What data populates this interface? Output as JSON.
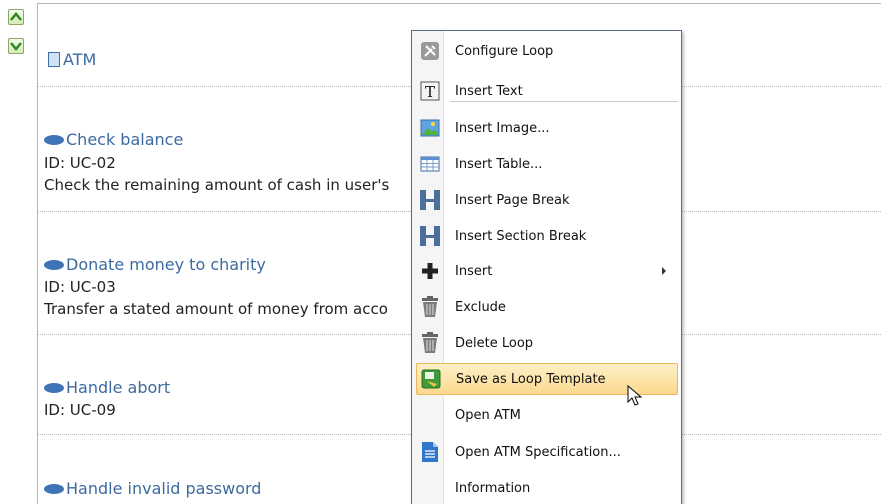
{
  "document": {
    "title": "ATM",
    "use_cases": [
      {
        "name": "Check balance",
        "id": "ID: UC-02",
        "description": "Check the remaining amount of cash in user's"
      },
      {
        "name": "Donate money to charity",
        "id": "ID: UC-03",
        "description": "Transfer a stated amount of money from acco"
      },
      {
        "name": "Handle abort",
        "id": "ID: UC-09"
      },
      {
        "name": "Handle invalid password"
      }
    ]
  },
  "context_menu": {
    "items": [
      {
        "label": "Configure Loop",
        "icon": "wrench-icon"
      },
      {
        "label": "Insert Text",
        "icon": "text-t-icon"
      },
      {
        "label": "Insert Image...",
        "icon": "image-icon"
      },
      {
        "label": "Insert Table...",
        "icon": "table-icon"
      },
      {
        "label": "Insert Page Break",
        "icon": "page-break-icon"
      },
      {
        "label": "Insert Section Break",
        "icon": "section-break-icon"
      },
      {
        "label": "Insert",
        "icon": "plus-icon",
        "has_submenu": true
      },
      {
        "label": "Exclude",
        "icon": "trash-icon"
      },
      {
        "label": "Delete Loop",
        "icon": "trash-icon"
      },
      {
        "label": "Save as Loop Template",
        "icon": "save-template-icon",
        "highlighted": true
      },
      {
        "label": "Open ATM"
      },
      {
        "label": "Open ATM Specification...",
        "icon": "document-icon"
      },
      {
        "label": "Information"
      }
    ]
  },
  "colors": {
    "accent": "#3c6aa0",
    "highlight": "#fbd98d"
  }
}
